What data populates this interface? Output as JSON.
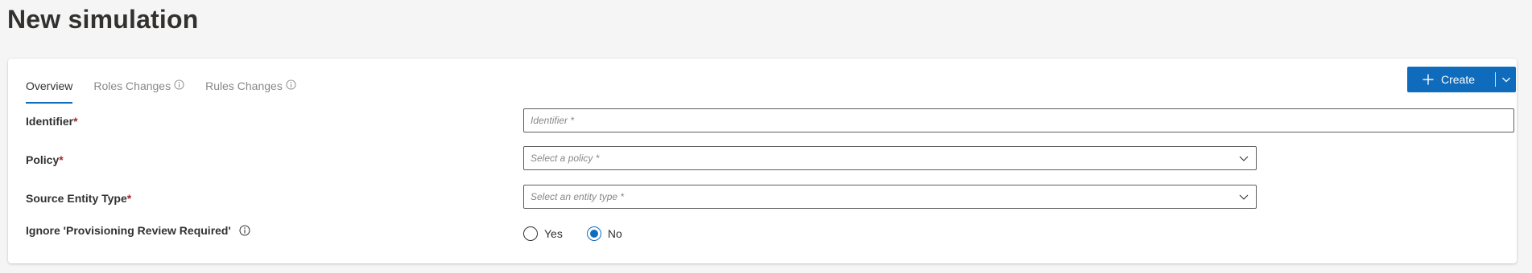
{
  "page": {
    "title": "New simulation"
  },
  "tabs": [
    {
      "label": "Overview",
      "active": true,
      "info_icon": false
    },
    {
      "label": "Roles Changes",
      "active": false,
      "info_icon": true
    },
    {
      "label": "Rules Changes",
      "active": false,
      "info_icon": true
    }
  ],
  "toolbar": {
    "create_label": "Create",
    "create_icon": "plus-icon",
    "split_icon": "chevron-down-icon",
    "accent_color": "#0f6cbd"
  },
  "form": {
    "identifier": {
      "label": "Identifier",
      "required_mark": "*",
      "value": "",
      "placeholder": "Identifier *"
    },
    "policy": {
      "label": "Policy",
      "required_mark": "*",
      "placeholder": "Select a policy *"
    },
    "source_entity_type": {
      "label": "Source Entity Type",
      "required_mark": "*",
      "placeholder": "Select an entity type *"
    },
    "ignore_review": {
      "label": "Ignore 'Provisioning Review Required'",
      "info_icon": "info-icon",
      "options": [
        {
          "label": "Yes",
          "checked": false
        },
        {
          "label": "No",
          "checked": true
        }
      ]
    }
  }
}
